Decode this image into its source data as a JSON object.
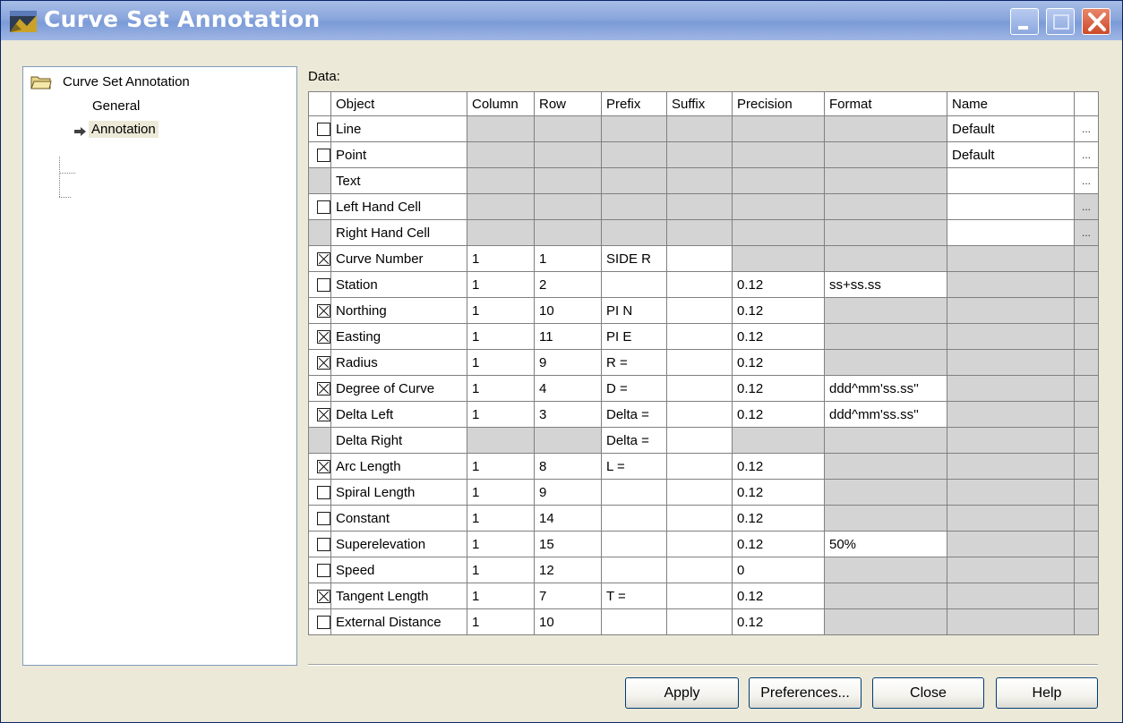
{
  "window": {
    "title": "Curve Set Annotation",
    "colors": {
      "titlebar": "#8aa6dc",
      "face": "#ece9d8",
      "grid_disabled": "#d4d4d4"
    }
  },
  "tree": {
    "root": "Curve Set Annotation",
    "children": [
      "General",
      "Annotation"
    ],
    "selected": "Annotation"
  },
  "data_label": "Data:",
  "grid": {
    "headers": [
      "Object",
      "Column",
      "Row",
      "Prefix",
      "Suffix",
      "Precision",
      "Format",
      "Name"
    ],
    "rows": [
      {
        "check": "off",
        "object": "Line",
        "column": "",
        "row": "",
        "prefix": "",
        "suffix": "",
        "precision": "",
        "format": "",
        "name": "Default"
      },
      {
        "check": "off",
        "object": "Point",
        "column": "",
        "row": "",
        "prefix": "",
        "suffix": "",
        "precision": "",
        "format": "",
        "name": "Default"
      },
      {
        "check": "none",
        "object": "Text",
        "column": "",
        "row": "",
        "prefix": "",
        "suffix": "",
        "precision": "",
        "format": "",
        "name": ""
      },
      {
        "check": "off",
        "object": "Left Hand Cell",
        "column": "",
        "row": "",
        "prefix": "",
        "suffix": "",
        "precision": "",
        "format": "",
        "name": ""
      },
      {
        "check": "none",
        "object": "Right Hand Cell",
        "column": "",
        "row": "",
        "prefix": "",
        "suffix": "",
        "precision": "",
        "format": "",
        "name": ""
      },
      {
        "check": "on",
        "object": "Curve Number",
        "column": "1",
        "row": "1",
        "prefix": "SIDE R",
        "suffix": "",
        "precision": "",
        "format": "",
        "name": ""
      },
      {
        "check": "off",
        "object": "Station",
        "column": "1",
        "row": "2",
        "prefix": "",
        "suffix": "",
        "precision": "0.12",
        "format": "ss+ss.ss",
        "name": ""
      },
      {
        "check": "on",
        "object": "Northing",
        "column": "1",
        "row": "10",
        "prefix": "PI N",
        "suffix": "",
        "precision": "0.12",
        "format": "",
        "name": ""
      },
      {
        "check": "on",
        "object": "Easting",
        "column": "1",
        "row": "11",
        "prefix": "PI E",
        "suffix": "",
        "precision": "0.12",
        "format": "",
        "name": ""
      },
      {
        "check": "on",
        "object": "Radius",
        "column": "1",
        "row": "9",
        "prefix": "R =",
        "suffix": "",
        "precision": "0.12",
        "format": "",
        "name": ""
      },
      {
        "check": "on",
        "object": "Degree of Curve",
        "column": "1",
        "row": "4",
        "prefix": "D =",
        "suffix": "",
        "precision": "0.12",
        "format": "ddd^mm'ss.ss''",
        "name": ""
      },
      {
        "check": "on",
        "object": "Delta Left",
        "column": "1",
        "row": "3",
        "prefix": "Delta =",
        "suffix": "",
        "precision": "0.12",
        "format": "ddd^mm'ss.ss''",
        "name": ""
      },
      {
        "check": "none",
        "object": "Delta Right",
        "column": "",
        "row": "",
        "prefix": "Delta =",
        "suffix": "",
        "precision": "",
        "format": "",
        "name": ""
      },
      {
        "check": "on",
        "object": "Arc Length",
        "column": "1",
        "row": "8",
        "prefix": "L =",
        "suffix": "",
        "precision": "0.12",
        "format": "",
        "name": ""
      },
      {
        "check": "off",
        "object": "Spiral Length",
        "column": "1",
        "row": "9",
        "prefix": "",
        "suffix": "",
        "precision": "0.12",
        "format": "",
        "name": ""
      },
      {
        "check": "off",
        "object": "Constant",
        "column": "1",
        "row": "14",
        "prefix": "",
        "suffix": "",
        "precision": "0.12",
        "format": "",
        "name": ""
      },
      {
        "check": "off",
        "object": "Superelevation",
        "column": "1",
        "row": "15",
        "prefix": "",
        "suffix": "",
        "precision": "0.12",
        "format": "50%",
        "name": ""
      },
      {
        "check": "off",
        "object": "Speed",
        "column": "1",
        "row": "12",
        "prefix": "",
        "suffix": "",
        "precision": "0",
        "format": "",
        "name": ""
      },
      {
        "check": "on",
        "object": "Tangent Length",
        "column": "1",
        "row": "7",
        "prefix": "T =",
        "suffix": "",
        "precision": "0.12",
        "format": "",
        "name": ""
      },
      {
        "check": "off",
        "object": "External Distance",
        "column": "1",
        "row": "10",
        "prefix": "",
        "suffix": "",
        "precision": "0.12",
        "format": "",
        "name": ""
      }
    ],
    "ellipsis": "..."
  },
  "buttons": {
    "apply": "Apply",
    "preferences": "Preferences...",
    "close": "Close",
    "help": "Help"
  }
}
